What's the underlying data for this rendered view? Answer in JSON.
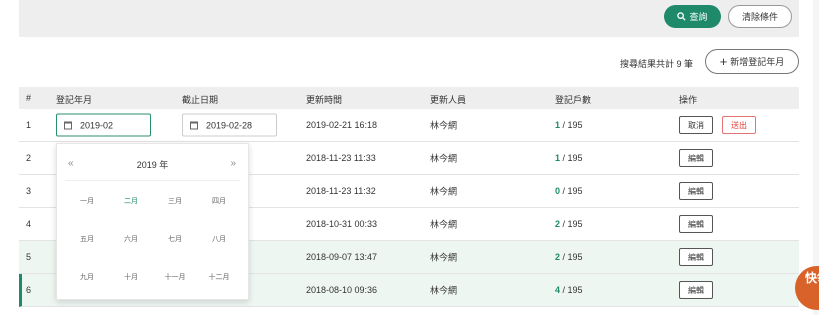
{
  "filter_bar": {
    "search_label": "查詢",
    "clear_label": "清除條件"
  },
  "toolbar": {
    "result_count": "搜尋結果共計 9 筆",
    "add_label": "新增登記年月"
  },
  "table": {
    "headers": [
      "#",
      "登記年月",
      "截止日期",
      "更新時間",
      "更新人員",
      "登記戶數",
      "操作"
    ],
    "total_households": "/ 195",
    "rows": [
      {
        "index": "1",
        "register_month": "2019-02",
        "deadline": "2019-02-28",
        "updated_at": "2019-02-21 16:18",
        "updated_by": "林今網",
        "count": "1"
      },
      {
        "index": "2",
        "updated_at": "2018-11-23 11:33",
        "updated_by": "林今網",
        "count": "1"
      },
      {
        "index": "3",
        "updated_at": "2018-11-23 11:32",
        "updated_by": "林今網",
        "count": "0"
      },
      {
        "index": "4",
        "updated_at": "2018-10-31 00:33",
        "updated_by": "林今網",
        "count": "2"
      },
      {
        "index": "5",
        "updated_at": "2018-09-07 13:47",
        "updated_by": "林今網",
        "count": "2"
      },
      {
        "index": "6",
        "updated_at": "2018-08-10 09:36",
        "updated_by": "林今網",
        "count": "4"
      }
    ],
    "actions": {
      "cancel": "取消",
      "send": "送出",
      "edit": "編輯"
    }
  },
  "month_picker": {
    "prev": "«",
    "next": "»",
    "year": "2019 年",
    "months": [
      "一月",
      "二月",
      "三月",
      "四月",
      "五月",
      "六月",
      "七月",
      "八月",
      "九月",
      "十月",
      "十一月",
      "十二月"
    ],
    "current_index": 1
  },
  "fab": {
    "label": "快領"
  },
  "colors": {
    "accent": "#1f8a6a",
    "danger": "#e53935",
    "fab": "#d9612a"
  }
}
